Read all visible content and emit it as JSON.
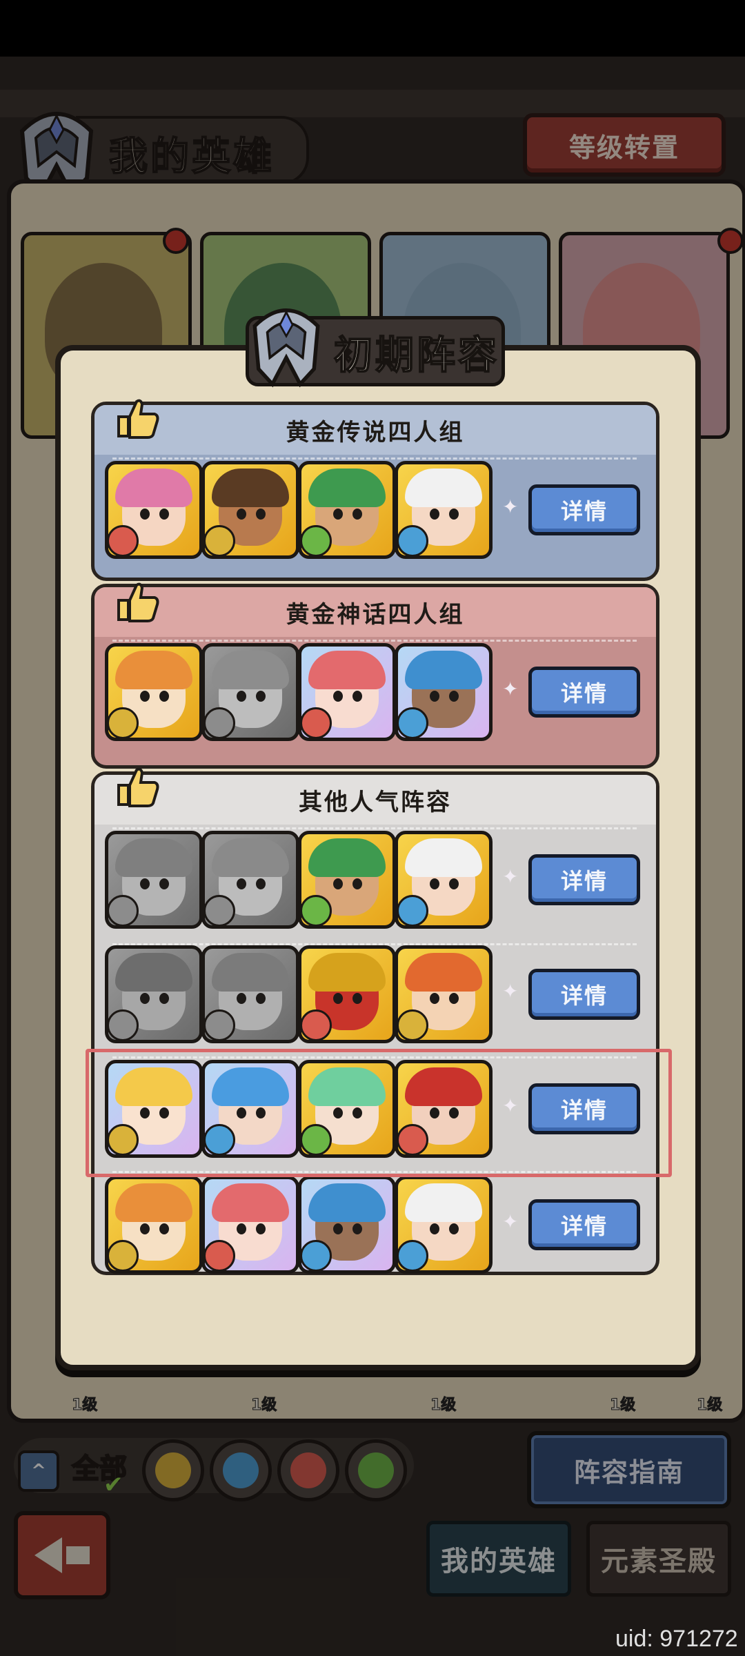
{
  "screen": {
    "title": "我的英雄",
    "reset_button": "等级转置",
    "level_labels": [
      "1级",
      "1级",
      "1级",
      "1级",
      "1级"
    ],
    "filter": {
      "all_label": "全部",
      "elements": [
        "earth",
        "water",
        "fire",
        "wind"
      ]
    },
    "guide_button": "阵容指南",
    "tabs": [
      "我的英雄",
      "元素圣殿"
    ],
    "uid": "uid: 971272"
  },
  "dialog": {
    "title": "初期阵容",
    "detail_label": "详情",
    "sections": [
      {
        "header": "黄金传说四人组",
        "rows": [
          {
            "heroes": [
              {
                "rarity": "gold",
                "element": "fire",
                "hair": "#e07aa8",
                "skin": "#f5d6c2"
              },
              {
                "rarity": "gold",
                "element": "earth",
                "hair": "#5a3b23",
                "skin": "#b87a4e"
              },
              {
                "rarity": "gold",
                "element": "wind",
                "hair": "#3e9a4f",
                "skin": "#d9a679"
              },
              {
                "rarity": "gold",
                "element": "water",
                "hair": "#f1f1f1",
                "skin": "#f5d8c4"
              }
            ]
          }
        ]
      },
      {
        "header": "黄金神话四人组",
        "rows": [
          {
            "heroes": [
              {
                "rarity": "gold",
                "element": "earth",
                "hair": "#e98f3a",
                "skin": "#f6e0c4"
              },
              {
                "rarity": "grey",
                "element": "none",
                "hair": "#8d8d8d",
                "skin": "#bdbdbd"
              },
              {
                "rarity": "myth",
                "element": "fire",
                "hair": "#e36a6d",
                "skin": "#f8dcd0"
              },
              {
                "rarity": "myth",
                "element": "water",
                "hair": "#3f8fcf",
                "skin": "#9a7257"
              }
            ]
          }
        ]
      },
      {
        "header": "其他人气阵容",
        "rows": [
          {
            "heroes": [
              {
                "rarity": "grey",
                "element": "none",
                "hair": "#7f7f7f",
                "skin": "#b4b4b4"
              },
              {
                "rarity": "grey",
                "element": "none",
                "hair": "#8a8a8a",
                "skin": "#bcbcbc"
              },
              {
                "rarity": "gold",
                "element": "wind",
                "hair": "#3e9a4f",
                "skin": "#d9a679"
              },
              {
                "rarity": "gold",
                "element": "water",
                "hair": "#f1f1f1",
                "skin": "#f5d8c4"
              }
            ]
          },
          {
            "heroes": [
              {
                "rarity": "grey",
                "element": "none",
                "hair": "#6d6d6d",
                "skin": "#a7a7a7"
              },
              {
                "rarity": "grey",
                "element": "none",
                "hair": "#7b7b7b",
                "skin": "#b0b0b0"
              },
              {
                "rarity": "gold",
                "element": "fire",
                "hair": "#d6a21c",
                "skin": "#c8342a"
              },
              {
                "rarity": "gold",
                "element": "earth",
                "hair": "#e2692f",
                "skin": "#f4d3b4"
              }
            ]
          },
          {
            "heroes": [
              {
                "rarity": "myth",
                "element": "earth",
                "hair": "#f4c94a",
                "skin": "#f9e2cf"
              },
              {
                "rarity": "myth",
                "element": "water",
                "hair": "#4a9ce0",
                "skin": "#f3d8c7"
              },
              {
                "rarity": "gold",
                "element": "wind",
                "hair": "#6fcf9e",
                "skin": "#f5dfcf"
              },
              {
                "rarity": "gold",
                "element": "fire",
                "hair": "#c9332c",
                "skin": "#f2d0bd"
              }
            ]
          },
          {
            "heroes": [
              {
                "rarity": "gold",
                "element": "earth",
                "hair": "#e98f3a",
                "skin": "#f6e0c4"
              },
              {
                "rarity": "myth",
                "element": "fire",
                "hair": "#e36a6d",
                "skin": "#f8dcd0"
              },
              {
                "rarity": "myth",
                "element": "water",
                "hair": "#3f8fcf",
                "skin": "#9a7257"
              },
              {
                "rarity": "gold",
                "element": "water",
                "hair": "#f1f1f1",
                "skin": "#f5d8c4"
              }
            ]
          }
        ]
      }
    ]
  },
  "colors": {
    "element_earth": "#d9b23a",
    "element_water": "#4b9fd6",
    "element_fire": "#d95b4e",
    "element_wind": "#6bb646",
    "detail_button": "#5c8bd4",
    "highlight_frame": "#d8696a"
  }
}
